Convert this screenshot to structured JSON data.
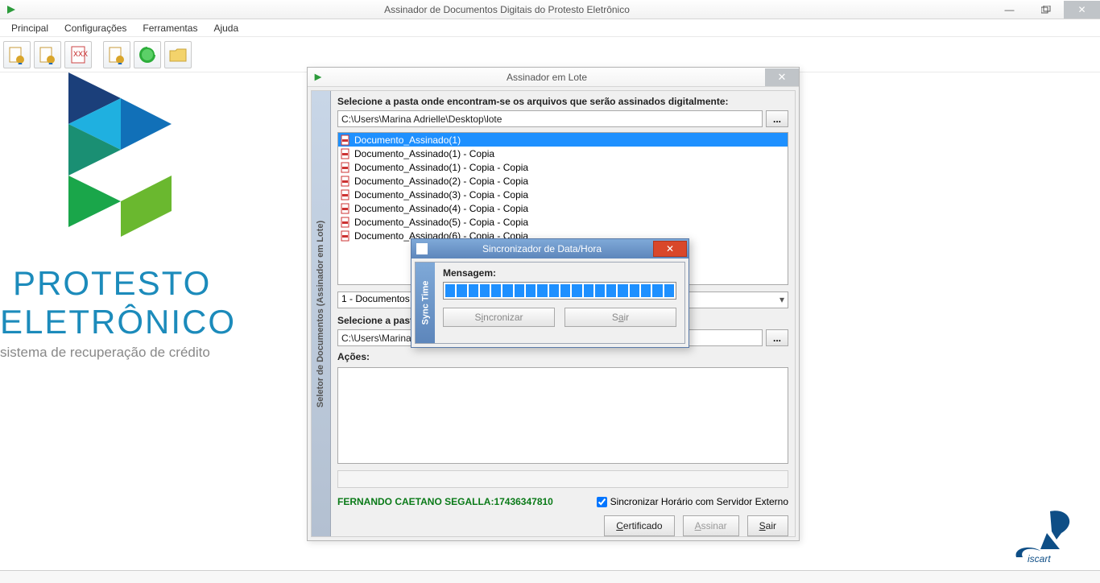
{
  "window": {
    "title": "Assinador de Documentos Digitais do Protesto Eletrônico"
  },
  "menu": {
    "principal": "Principal",
    "config": "Configurações",
    "ferramentas": "Ferramentas",
    "ajuda": "Ajuda"
  },
  "logo": {
    "line1": "PROTESTO",
    "line2": "ELETRÔNICO",
    "line3": "sistema de recuperação de crédito"
  },
  "dialog": {
    "title": "Assinador em Lote",
    "sideTab": "Seletor de Documentos (Assinador em Lote)",
    "label1": "Selecione a pasta onde encontram-se os arquivos que serão assinados digitalmente:",
    "path1": "C:\\Users\\Marina Adrielle\\Desktop\\lote",
    "files": [
      "Documento_Assinado(1)",
      "Documento_Assinado(1) - Copia",
      "Documento_Assinado(1) - Copia - Copia",
      "Documento_Assinado(2) - Copia - Copia",
      "Documento_Assinado(3) - Copia - Copia",
      "Documento_Assinado(4) - Copia - Copia",
      "Documento_Assinado(5) - Copia - Copia",
      "Documento_Assinado(6) - Copia - Copia"
    ],
    "combo": "1 - Documentos do",
    "label2": "Selecione a pasta",
    "path2": "C:\\Users\\Marina Ad",
    "acoes": "Ações:",
    "signer": "FERNANDO CAETANO SEGALLA:17436347810",
    "checkbox": "Sincronizar Horário com Servidor Externo",
    "btnCert": "Certificado",
    "btnAssinar": "Assinar",
    "btnSair": "Sair"
  },
  "sync": {
    "title": "Sincronizador de Data/Hora",
    "side": "Sync Time",
    "label": "Mensagem:",
    "btnSync": "Sincronizar",
    "btnSair": "Sair"
  },
  "siscart": "iscart"
}
